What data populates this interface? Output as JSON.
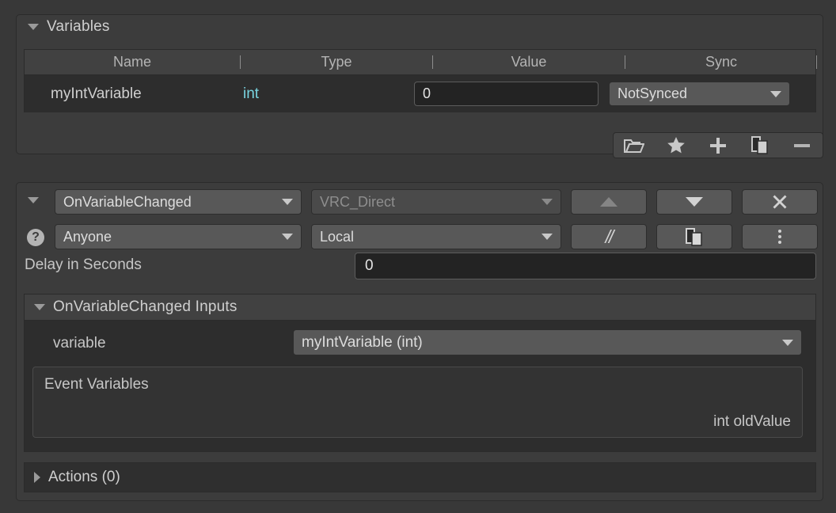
{
  "variables_panel": {
    "title": "Variables",
    "columns": [
      "Name",
      "Type",
      "Value",
      "Sync"
    ],
    "rows": [
      {
        "name": "myIntVariable",
        "type": "int",
        "value": "0",
        "sync": "NotSynced"
      }
    ],
    "toolbar": [
      {
        "icon": "folder-icon",
        "name": "open-folder-button"
      },
      {
        "icon": "star-icon",
        "name": "favorite-button"
      },
      {
        "icon": "plus-icon",
        "name": "add-variable-button"
      },
      {
        "icon": "duplicate-icon",
        "name": "duplicate-variable-button"
      },
      {
        "icon": "minus-icon",
        "name": "remove-variable-button"
      }
    ]
  },
  "event_panel": {
    "event_name": "OnVariableChanged",
    "event_source": "VRC_Direct",
    "permission": "Anyone",
    "network": "Local",
    "buttons": {
      "move_up": "move-up",
      "move_down": "move-down",
      "close": "close",
      "comment": "//",
      "duplicate": "duplicate",
      "more": "more-options"
    },
    "delay": {
      "label": "Delay in Seconds",
      "value": "0"
    },
    "inputs": {
      "title": "OnVariableChanged Inputs",
      "variable_label": "variable",
      "variable_value": "myIntVariable (int)",
      "event_variables_title": "Event Variables",
      "event_variables": [
        "int oldValue"
      ]
    },
    "actions": {
      "label": "Actions (0)"
    }
  },
  "colors": {
    "background": "#383838",
    "panel": "#3c3c3c",
    "row": "#2d2d2d",
    "field": "#232323",
    "dropdown": "#585858",
    "text": "#cfcfcf",
    "type_accent": "#79d4e0"
  }
}
